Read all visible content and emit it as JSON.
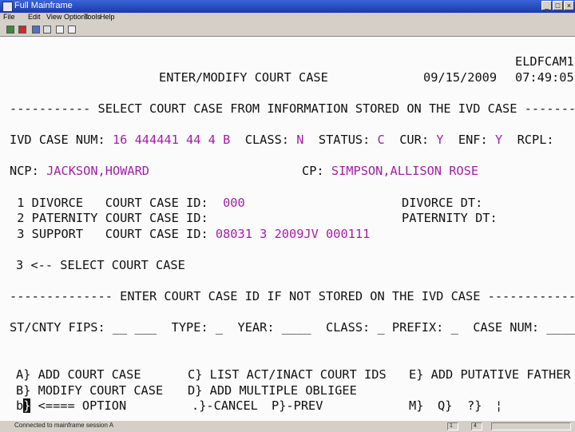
{
  "window": {
    "title": "Full Mainframe",
    "min": "_",
    "max": "□",
    "close": "×"
  },
  "menu": [
    "File",
    "Edit",
    "View",
    "Options",
    "Tools",
    "Help"
  ],
  "header": {
    "system_id": "ELDFCAM1",
    "title": "ENTER/MODIFY COURT CASE",
    "date": "09/15/2009",
    "time": "07:49:05"
  },
  "select_rule": "----------- SELECT COURT CASE FROM INFORMATION STORED ON THE IVD CASE ---------",
  "case": {
    "ivd_label": "IVD CASE NUM:",
    "ivd_value": "16 444441 44 4 B",
    "class_label": "CLASS:",
    "class_value": "N",
    "status_label": "STATUS:",
    "status_value": "C",
    "cur_label": "CUR:",
    "cur_value": "Y",
    "enf_label": "ENF:",
    "enf_value": "Y",
    "rcpl_label": "RCPL:"
  },
  "parties": {
    "ncp_label": "NCP:",
    "ncp_value": "JACKSON,HOWARD",
    "cp_label": "CP:",
    "cp_value": "SIMPSON,ALLISON ROSE"
  },
  "court_cases": [
    {
      "label": " 1 DIVORCE   COURT CASE ID:",
      "value": " 000",
      "dt_label": "DIVORCE DT:"
    },
    {
      "label": " 2 PATERNITY COURT CASE ID:",
      "value": "",
      "dt_label": "PATERNITY DT:"
    },
    {
      "label": " 3 SUPPORT   COURT CASE ID:",
      "value": "08031 3 2009JV 000111",
      "dt_label": ""
    }
  ],
  "selection": {
    "value": "3",
    "prompt": "<-- SELECT COURT CASE"
  },
  "enter_rule": "-------------- ENTER COURT CASE ID IF NOT STORED ON THE IVD CASE ------------",
  "fips_line": "ST/CNTY FIPS: __ ___  TYPE: _  YEAR: ____  CLASS: _ PREFIX: _  CASE NUM: ______",
  "options": {
    "a": "A} ADD COURT CASE",
    "c": "C} LIST ACT/INACT COURT IDS",
    "e": "E} ADD PUTATIVE FATHER",
    "b": "B} MODIFY COURT CASE",
    "d": "D} ADD MULTIPLE OBLIGEE",
    "input_prefix": "b",
    "input_cursor": "}",
    "input_label": " <==== OPTION",
    "cancel": ".}-CANCEL",
    "prev": "P}-PREV",
    "m": "M}",
    "q": "Q}",
    "help": "?}",
    "pipe": "¦"
  },
  "status": {
    "text": "Connected to mainframe session A",
    "cell1": "1",
    "cell2": "4"
  }
}
